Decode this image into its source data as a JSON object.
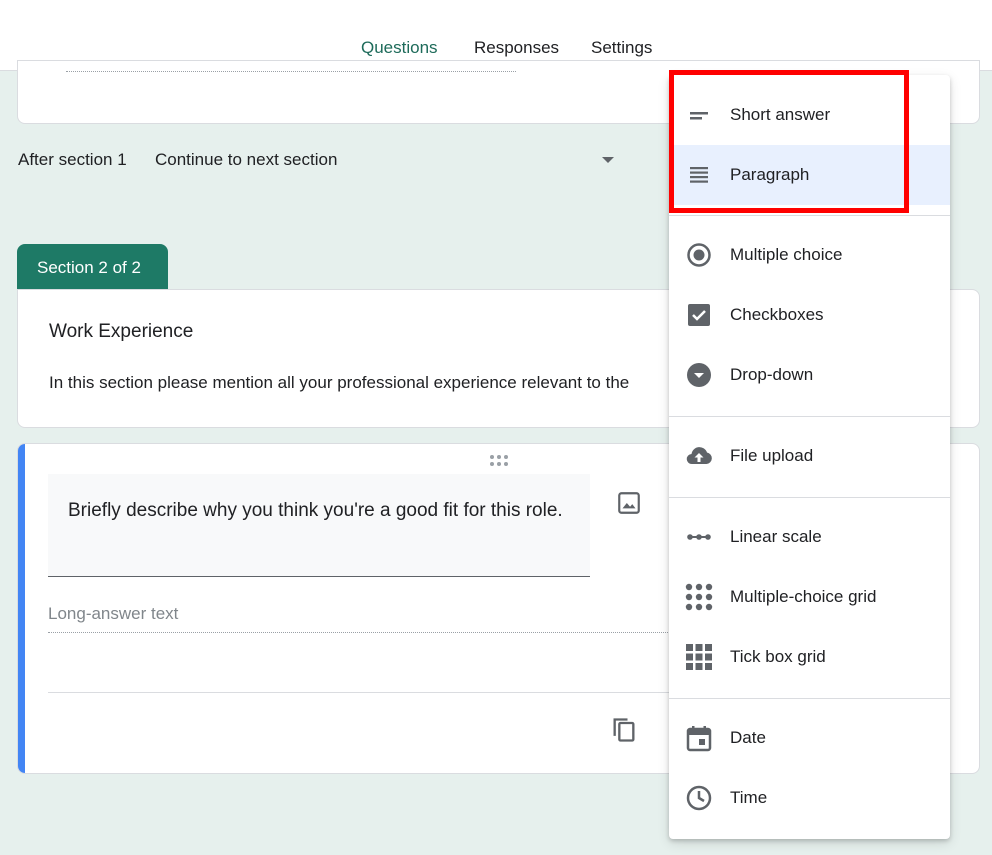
{
  "tabs": [
    {
      "label": "Questions",
      "active": true
    },
    {
      "label": "Responses",
      "active": false
    },
    {
      "label": "Settings",
      "active": false
    }
  ],
  "section_nav": {
    "after_label": "After section 1",
    "selected": "Continue to next section"
  },
  "section": {
    "badge": "Section 2 of 2",
    "title": "Work Experience",
    "description": "In this section please mention all your professional experience relevant to the"
  },
  "question": {
    "text": "Briefly describe why you think you're a good fit for this role.",
    "answer_placeholder": "Long-answer text"
  },
  "menu": {
    "items": [
      {
        "label": "Short answer",
        "icon": "short-answer-icon"
      },
      {
        "label": "Paragraph",
        "icon": "paragraph-icon",
        "highlighted": true
      },
      {
        "label": "Multiple choice",
        "icon": "radio-icon"
      },
      {
        "label": "Checkboxes",
        "icon": "checkbox-icon"
      },
      {
        "label": "Drop-down",
        "icon": "dropdown-icon"
      },
      {
        "label": "File upload",
        "icon": "cloud-upload-icon"
      },
      {
        "label": "Linear scale",
        "icon": "linear-scale-icon"
      },
      {
        "label": "Multiple-choice grid",
        "icon": "dot-grid-icon"
      },
      {
        "label": "Tick box grid",
        "icon": "square-grid-icon"
      },
      {
        "label": "Date",
        "icon": "calendar-icon"
      },
      {
        "label": "Time",
        "icon": "clock-icon"
      }
    ]
  },
  "colors": {
    "accent": "#1e7a66",
    "question_accent": "#4285f4",
    "highlight": "#ff0000",
    "menu_hover": "#e8f0fe"
  }
}
